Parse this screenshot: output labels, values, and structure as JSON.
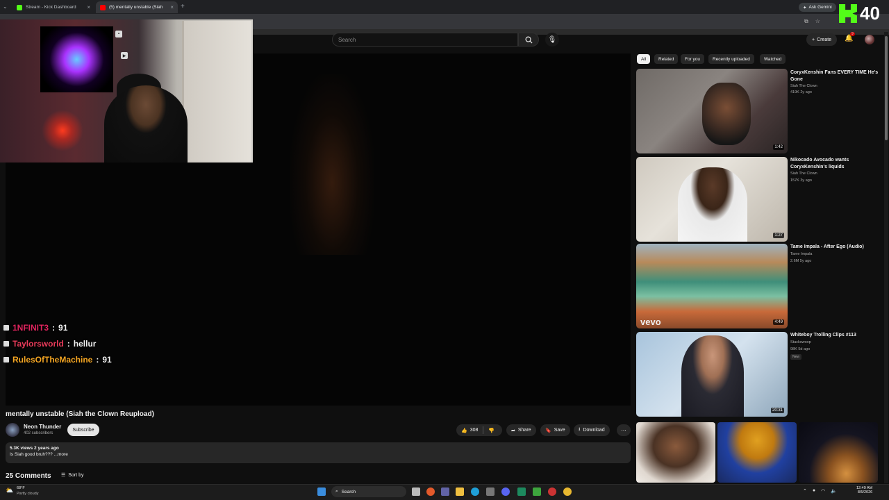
{
  "browser": {
    "tabs": [
      {
        "title": "Stream - Kick Dashboard",
        "favicon_color": "#53fc18"
      },
      {
        "title": "(5) mentally unstable (Siah",
        "favicon_color": "#ff0000"
      }
    ],
    "ask_gemini": "Ask Gemini"
  },
  "kick_overlay": {
    "count": "40"
  },
  "header": {
    "search_placeholder": "Search",
    "create_label": "Create",
    "notification_count": "9"
  },
  "chat_overlay": [
    {
      "user": "1NFINIT3",
      "message": "91",
      "color": "#e0245e"
    },
    {
      "user": "Taylorsworld",
      "message": "hellur",
      "color": "#e83b5a"
    },
    {
      "user": "RulesOfTheMachine",
      "message": "91",
      "color": "#f5a623"
    }
  ],
  "video": {
    "title": "mentally unstable (Siah the Clown Reupload)",
    "channel": "Neon Thunder",
    "subscribers": "402 subscribers",
    "subscribe_label": "Subscribe",
    "likes": "308",
    "share_label": "Share",
    "save_label": "Save",
    "download_label": "Download",
    "views_line": "5.3K views  2 years ago",
    "description": "Is Siah good bruh???  ...more",
    "comments_count": "25 Comments",
    "sort_label": "Sort by"
  },
  "sidebar": {
    "chips": [
      "All",
      "Related",
      "For you",
      "Recently uploaded",
      "Watched"
    ],
    "videos": [
      {
        "title": "CoryxKenshin Fans EVERY TIME He's Gone",
        "channel": "Siah The Clown",
        "meta": "419K  2y ago",
        "duration": "1:42"
      },
      {
        "title": "Nikocado Avocado wants CoryxKenshin's liquids",
        "channel": "Siah The Clown",
        "meta": "157K  3y ago",
        "duration": "1:27"
      },
      {
        "title": "Tame Impala - After Ego (Audio)",
        "channel": "Tame Impala",
        "meta": "2.6M  5y ago",
        "duration": "4:49",
        "watermark": "vevo"
      },
      {
        "title": "Whiteboy Trolling Clips #113",
        "channel": "Stackswoop",
        "meta": "98K  5d ago",
        "duration": "20:31",
        "badge": "New"
      }
    ]
  },
  "taskbar": {
    "weather_temp": "68°F",
    "weather_desc": "Partly cloudy",
    "search_label": "Search",
    "time": "12:49 AM",
    "date": "8/5/2026"
  }
}
